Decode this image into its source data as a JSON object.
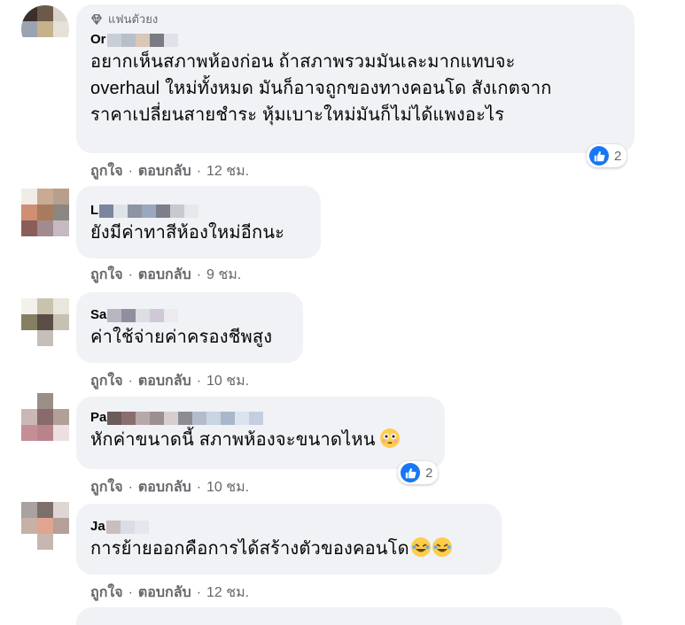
{
  "comments": [
    {
      "badge": "แฟนตัวยง",
      "name_prefix": "Or",
      "lines": [
        "อยากเห็นสภาพห้องก่อน ถ้าสภาพรวมมันเละมากแทบจะ",
        "overhaul ใหม่ทั้งหมด มันก็อาจถูกของทางคอนโด สังเกตจาก",
        "ราคาเปลี่ยนสายชำระ หุ้มเบาะใหม่มันก็ไม่ได้แพงอะไร"
      ],
      "like": "ถูกใจ",
      "reply": "ตอบกลับ",
      "time": "12 ชม.",
      "reaction_count": "2"
    },
    {
      "name_prefix": "L",
      "lines": [
        "ยังมีค่าทาสีห้องใหม่อีกนะ"
      ],
      "like": "ถูกใจ",
      "reply": "ตอบกลับ",
      "time": "9 ชม."
    },
    {
      "name_prefix": "Sa",
      "lines": [
        "ค่าใช้จ่ายค่าครองชีพสูง"
      ],
      "like": "ถูกใจ",
      "reply": "ตอบกลับ",
      "time": "10 ชม."
    },
    {
      "name_prefix": "Pa",
      "lines": [
        "หักค่าขนาดนี้ สภาพห้องจะขนาดไหน"
      ],
      "emoji": "flushed-face",
      "like": "ถูกใจ",
      "reply": "ตอบกลับ",
      "time": "10 ชม.",
      "reaction_count": "2"
    },
    {
      "name_prefix": "Ja",
      "lines": [
        "การย้ายออกคือการได้สร้างตัวของคอนโด"
      ],
      "emoji": "rolling-on-floor-laughing x2",
      "like": "ถูกใจ",
      "reply": "ตอบกลับ",
      "time": "12 ชม."
    }
  ],
  "colors": {
    "bubble": "#f0f2f5",
    "meta": "#65676b",
    "like_blue": "#1877f2"
  }
}
